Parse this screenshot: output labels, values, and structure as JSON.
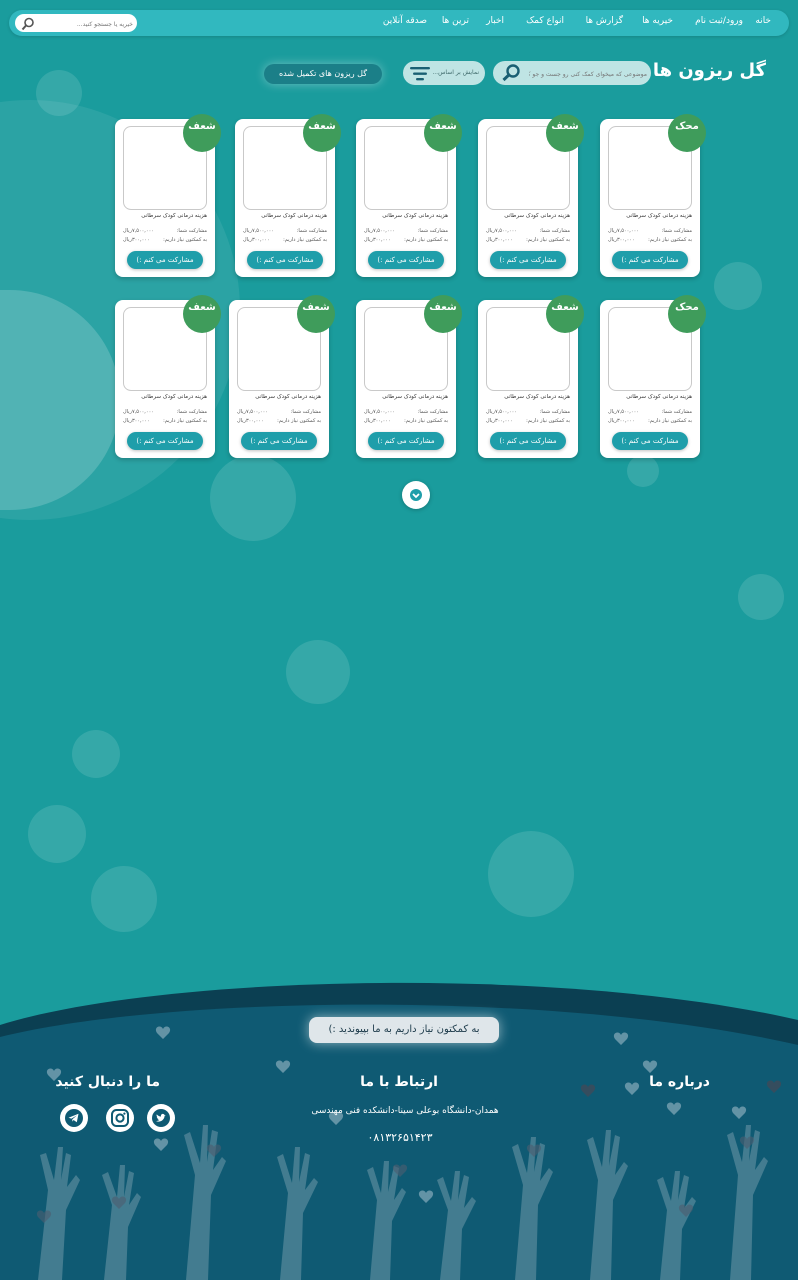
{
  "nav": {
    "items": [
      "خانه",
      "ورود/ثبت نام",
      "خیریه ها",
      "گزارش ها",
      "انواع کمک",
      "اخبار",
      "ترین ها",
      "صدقه آنلاین"
    ],
    "search_placeholder": "خیریه یا جستجو کنید..."
  },
  "header": {
    "title": "گل ریزون ها",
    "search_placeholder": "موضوعی که میخوای کمک کنی رو جست و جو کن...",
    "filter_label": "نمایش بر اساس...",
    "done_button": "گل ریزون های تکمیل شده"
  },
  "cards": [
    {
      "badge": "محک",
      "title": "هزینه درمانی کودک سرطانی",
      "label1": "مشارکت شما:",
      "value1": "۷,۵۰۰,۰۰۰ریال",
      "label2": "به کمکتون نیاز داریم:",
      "value2": "۳۰۰,۰۰۰ریال",
      "button": "مشارکت می کنم :)"
    },
    {
      "badge": "شعف",
      "title": "هزینه درمانی کودک سرطانی",
      "label1": "مشارکت شما:",
      "value1": "۷,۵۰۰,۰۰۰ریال",
      "label2": "به کمکتون نیاز داریم:",
      "value2": "۳۰۰,۰۰۰ریال",
      "button": "مشارکت می کنم :)"
    },
    {
      "badge": "شعف",
      "title": "هزینه درمانی کودک سرطانی",
      "label1": "مشارکت شما:",
      "value1": "۷,۵۰۰,۰۰۰ریال",
      "label2": "به کمکتون نیاز داریم:",
      "value2": "۳۰۰,۰۰۰ریال",
      "button": "مشارکت می کنم :)"
    },
    {
      "badge": "شعف",
      "title": "هزینه درمانی کودک سرطانی",
      "label1": "مشارکت شما:",
      "value1": "۷,۵۰۰,۰۰۰ریال",
      "label2": "به کمکتون نیاز داریم:",
      "value2": "۳۰۰,۰۰۰ریال",
      "button": "مشارکت می کنم :)"
    },
    {
      "badge": "شعف",
      "title": "هزینه درمانی کودک سرطانی",
      "label1": "مشارکت شما:",
      "value1": "۷,۵۰۰,۰۰۰ریال",
      "label2": "به کمکتون نیاز داریم:",
      "value2": "۳۰۰,۰۰۰ریال",
      "button": "مشارکت می کنم :)"
    },
    {
      "badge": "محک",
      "title": "هزینه درمانی کودک سرطانی",
      "label1": "مشارکت شما:",
      "value1": "۷,۵۰۰,۰۰۰ریال",
      "label2": "به کمکتون نیاز داریم:",
      "value2": "۳۰۰,۰۰۰ریال",
      "button": "مشارکت می کنم :)"
    },
    {
      "badge": "شعف",
      "title": "هزینه درمانی کودک سرطانی",
      "label1": "مشارکت شما:",
      "value1": "۷,۵۰۰,۰۰۰ریال",
      "label2": "به کمکتون نیاز داریم:",
      "value2": "۳۰۰,۰۰۰ریال",
      "button": "مشارکت می کنم :)"
    },
    {
      "badge": "شعف",
      "title": "هزینه درمانی کودک سرطانی",
      "label1": "مشارکت شما:",
      "value1": "۷,۵۰۰,۰۰۰ریال",
      "label2": "به کمکتون نیاز داریم:",
      "value2": "۳۰۰,۰۰۰ریال",
      "button": "مشارکت می کنم :)"
    },
    {
      "badge": "شعف",
      "title": "هزینه درمانی کودک سرطانی",
      "label1": "مشارکت شما:",
      "value1": "۷,۵۰۰,۰۰۰ریال",
      "label2": "به کمکتون نیاز داریم:",
      "value2": "۳۰۰,۰۰۰ریال",
      "button": "مشارکت می کنم :)"
    },
    {
      "badge": "شعف",
      "title": "هزینه درمانی کودک سرطانی",
      "label1": "مشارکت شما:",
      "value1": "۷,۵۰۰,۰۰۰ریال",
      "label2": "به کمکتون نیاز داریم:",
      "value2": "۳۰۰,۰۰۰ریال",
      "button": "مشارکت می کنم :)"
    }
  ],
  "footer": {
    "cta": "به کمکتون نیاز داریم به ما بپیوندید :)",
    "about_title": "درباره ما",
    "contact_title": "ارتباط با ما",
    "address": "همدان-دانشگاه بوعلی سینا-دانشکده فنی مهندسی",
    "phone": "۰۸۱۳۲۶۵۱۴۲۳",
    "follow_title": "ما را دنبال کنید",
    "social": [
      "telegram-icon",
      "instagram-icon",
      "twitter-icon"
    ]
  },
  "colors": {
    "background": "#1a9c9d",
    "nav": "#31b8bf",
    "badge": "#3f9c5b",
    "button": "#1f9eaa",
    "footer": "#0f5a73"
  }
}
